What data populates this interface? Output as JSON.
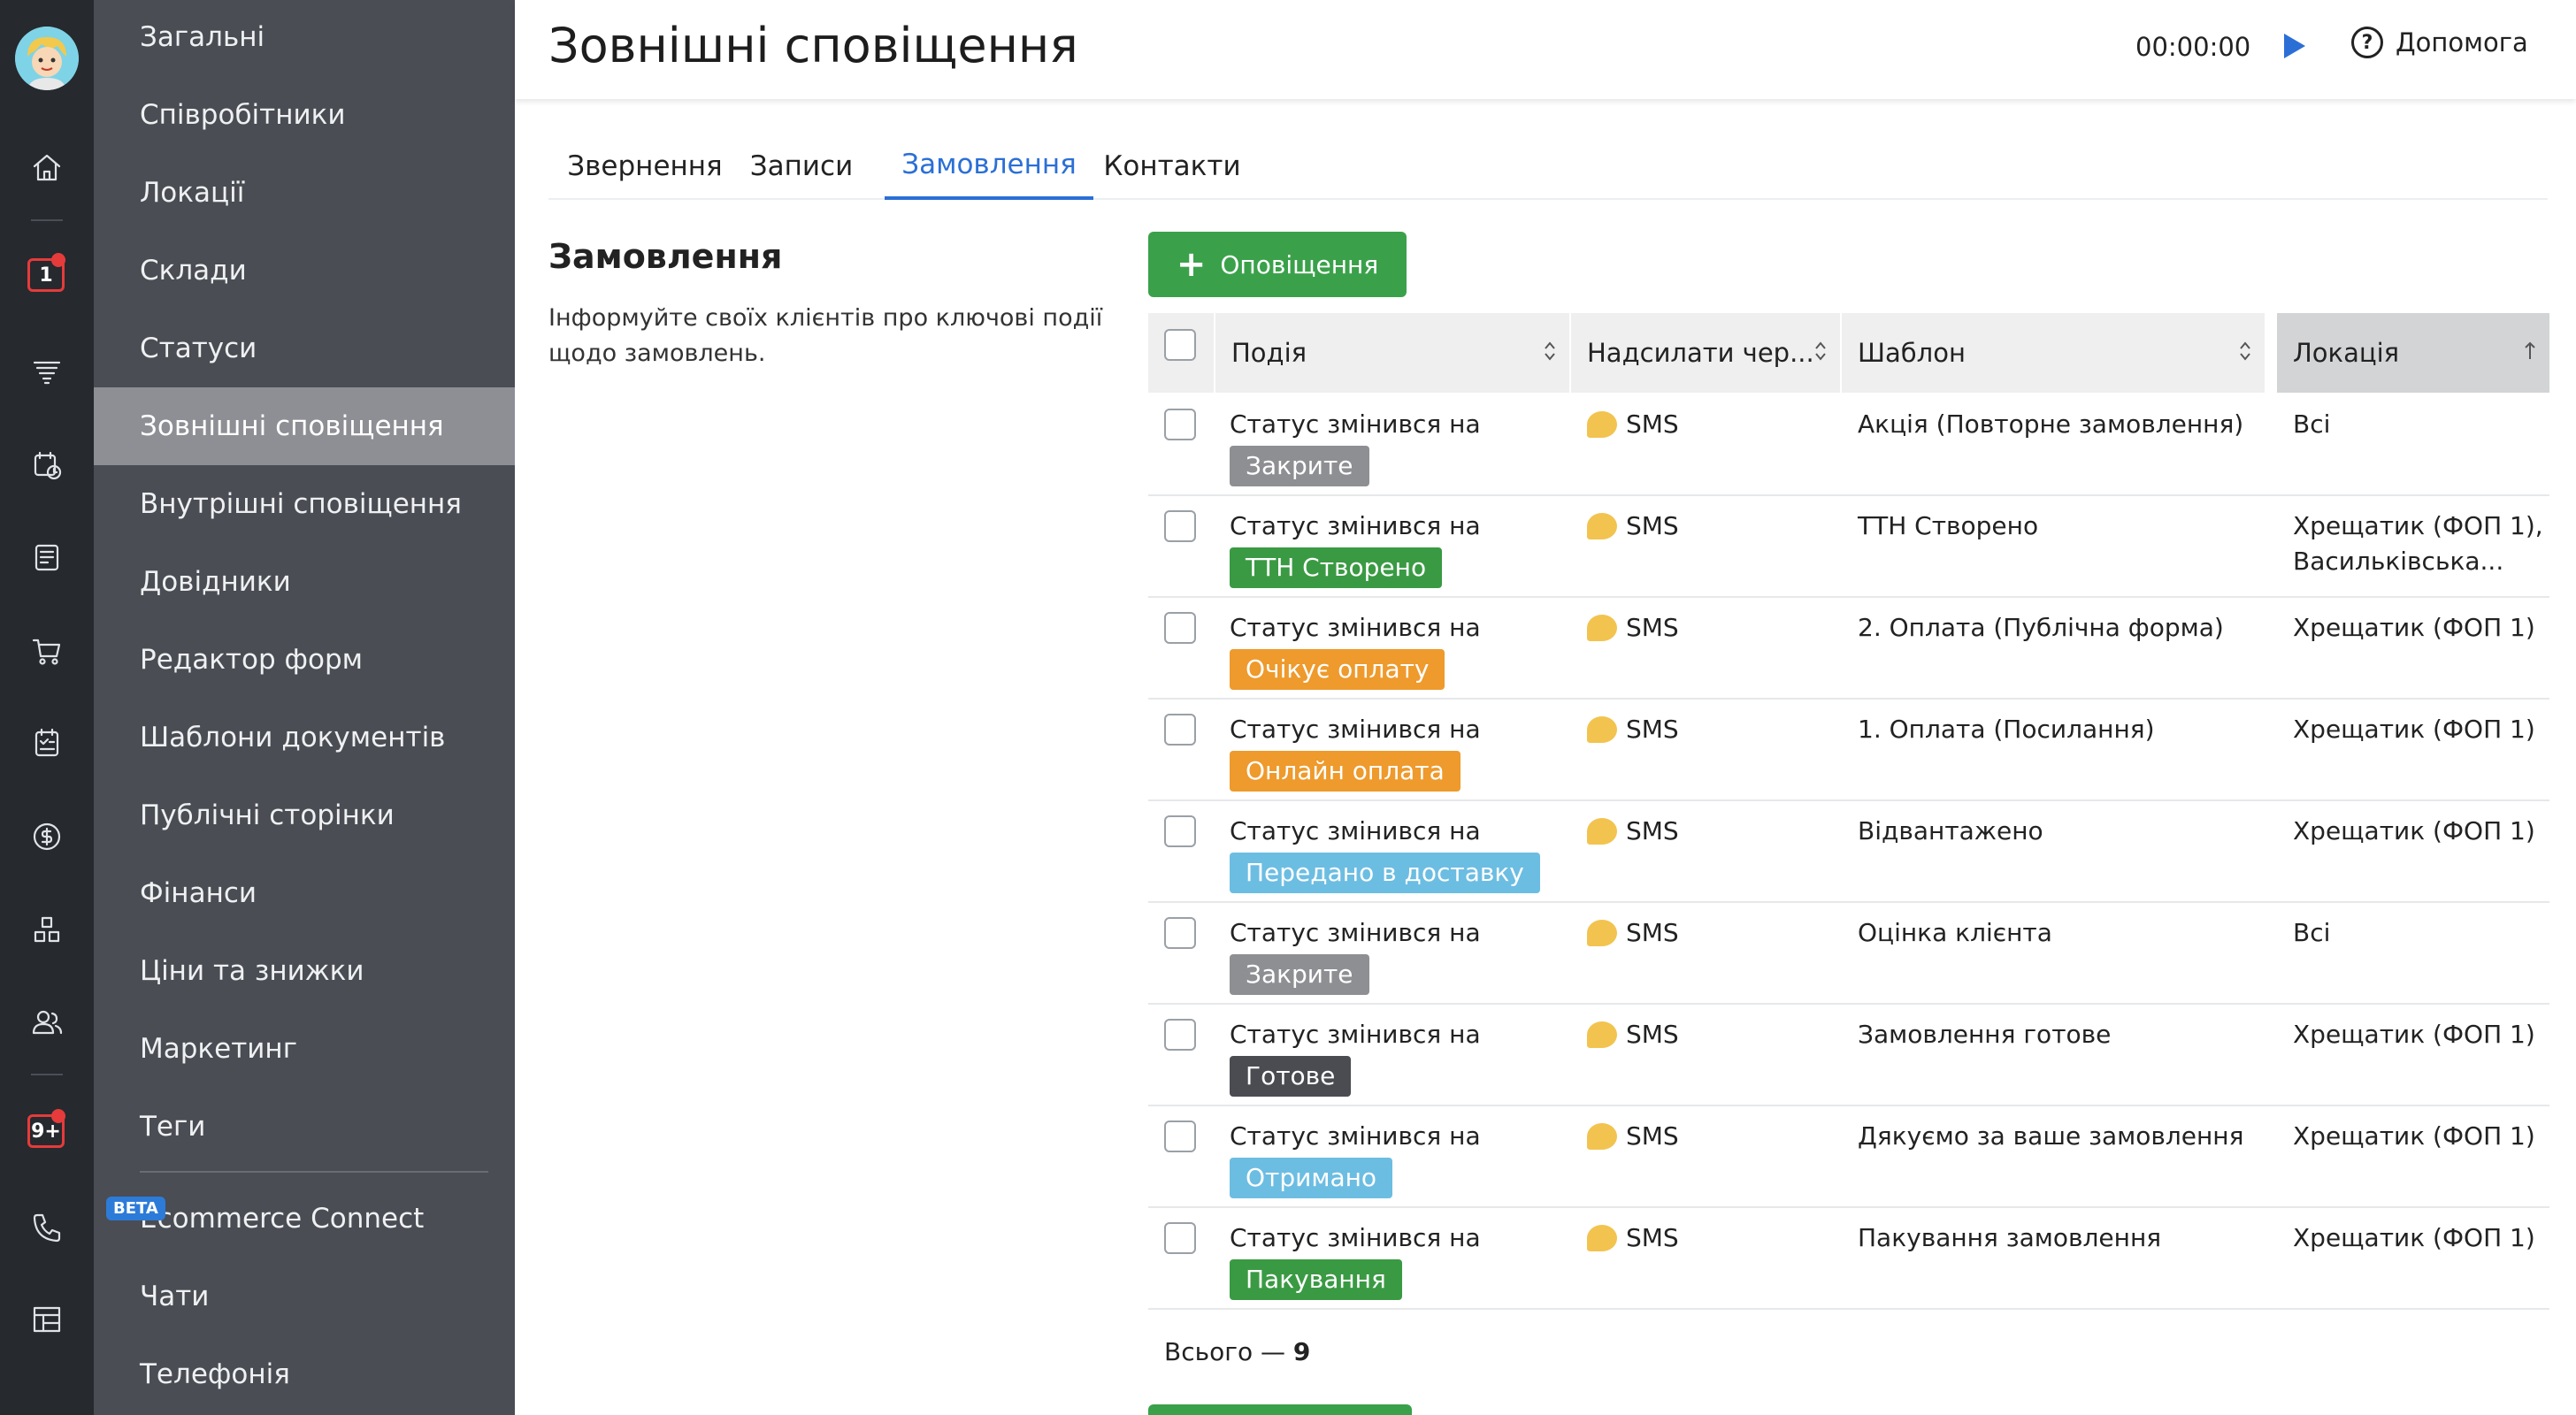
{
  "header": {
    "title": "Зовнішні сповіщення",
    "timer": "00:00:00",
    "help_label": "Допомога"
  },
  "rail": {
    "icons": [
      "home-icon",
      "calendar-icon",
      "funnel-icon",
      "schedule-icon",
      "invoice-icon",
      "cart-icon",
      "tasks-icon",
      "finance-icon",
      "warehouse-icon",
      "clients-icon",
      "notifications-icon",
      "phone-icon",
      "dashboard-icon"
    ],
    "calendar_badge": "1",
    "notifications_badge": "9+"
  },
  "menu": {
    "items": [
      "Загальні",
      "Співробітники",
      "Локації",
      "Склади",
      "Статуси",
      "Зовнішні сповіщення",
      "Внутрішні сповіщення",
      "Довідники",
      "Редактор форм",
      "Шаблони документів",
      "Публічні сторінки",
      "Фінанси",
      "Ціни та знижки",
      "Маркетинг",
      "Теги",
      "Ecommerce Connect",
      "Чати",
      "Телефонія"
    ],
    "active": "Зовнішні сповіщення",
    "beta_label": "BETA"
  },
  "tabs": [
    "Звернення",
    "Записи",
    "Замовлення",
    "Контакти"
  ],
  "active_tab": "Замовлення",
  "section": {
    "title": "Замовлення",
    "description": "Інформуйте своїх клієнтів про ключові події щодо замовлень."
  },
  "add_button": "Оповіщення",
  "table": {
    "headers": [
      "Подія",
      "Надсилати чер...",
      "Шаблон",
      "Локація"
    ],
    "rows": [
      {
        "event": "Статус змінився на",
        "status": "Закрите",
        "status_color": "#8e8f93",
        "channel": "SMS",
        "template": "Акція (Повторне замовлення)",
        "location": "Всі"
      },
      {
        "event": "Статус змінився на",
        "status": "ТТН Створено",
        "status_color": "#3a9a43",
        "channel": "SMS",
        "template": "ТТН Створено",
        "location": "Хрещатик (ФОП 1),",
        "location2": "Васильківська..."
      },
      {
        "event": "Статус змінився на",
        "status": "Очікує оплату",
        "status_color": "#ee9a2c",
        "channel": "SMS",
        "template": "2. Оплата (Публічна форма)",
        "location": "Хрещатик (ФОП 1)"
      },
      {
        "event": "Статус змінився на",
        "status": "Онлайн оплата",
        "status_color": "#ee9a2c",
        "channel": "SMS",
        "template": "1. Оплата (Посилання)",
        "location": "Хрещатик (ФОП 1)"
      },
      {
        "event": "Статус змінився на",
        "status": "Передано в доставку",
        "status_color": "#6cbde2",
        "channel": "SMS",
        "template": "Відвантажено",
        "location": "Хрещатик (ФОП 1)"
      },
      {
        "event": "Статус змінився на",
        "status": "Закрите",
        "status_color": "#8e8f93",
        "channel": "SMS",
        "template": "Оцінка клієнта",
        "location": "Всі"
      },
      {
        "event": "Статус змінився на",
        "status": "Готове",
        "status_color": "#4a4c51",
        "channel": "SMS",
        "template": "Замовлення готове",
        "location": "Хрещатик (ФОП 1)"
      },
      {
        "event": "Статус змінився на",
        "status": "Отримано",
        "status_color": "#6cbde2",
        "channel": "SMS",
        "template": "Дякуємо за ваше замовлення",
        "location": "Хрещатик (ФОП 1)"
      },
      {
        "event": "Статус змінився на",
        "status": "Пакування",
        "status_color": "#3a9a43",
        "channel": "SMS",
        "template": "Пакування замовлення",
        "location": "Хрещатик (ФОП 1)"
      }
    ],
    "total_label": "Всього —",
    "total_count": "9"
  }
}
